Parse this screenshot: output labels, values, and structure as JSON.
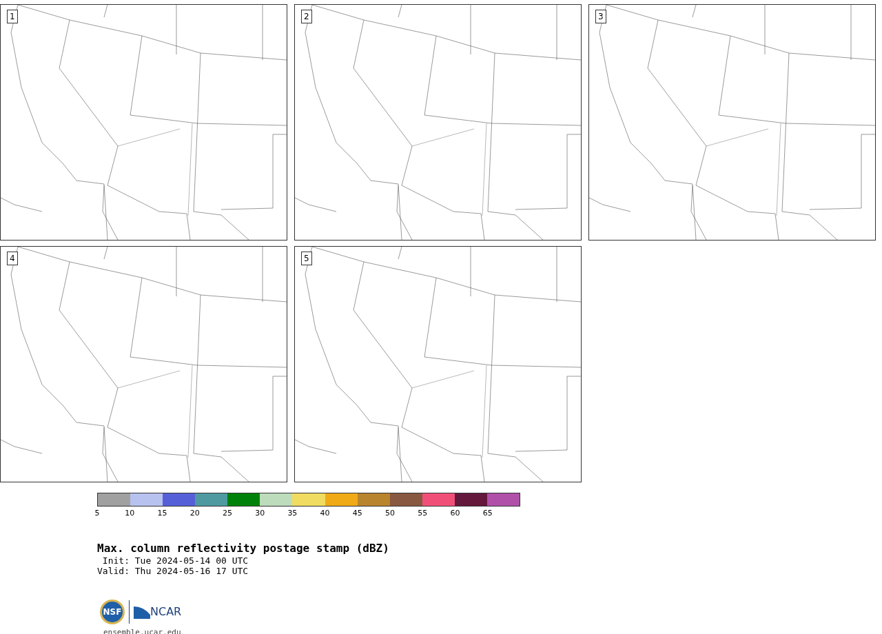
{
  "panels": [
    {
      "number": "1"
    },
    {
      "number": "2"
    },
    {
      "number": "3"
    },
    {
      "number": "4"
    },
    {
      "number": "5"
    }
  ],
  "colorbar": {
    "bins": [
      {
        "color": "#a0a0a0"
      },
      {
        "color": "#b8c2ef"
      },
      {
        "color": "#5560d8"
      },
      {
        "color": "#4e9aa0"
      },
      {
        "color": "#00820a"
      },
      {
        "color": "#bcdcbc"
      },
      {
        "color": "#f0dc60"
      },
      {
        "color": "#f0aa18"
      },
      {
        "color": "#b8842e"
      },
      {
        "color": "#885840"
      },
      {
        "color": "#f05078"
      },
      {
        "color": "#64183c"
      },
      {
        "color": "#b050a8"
      }
    ],
    "ticks": [
      "5",
      "10",
      "15",
      "20",
      "25",
      "30",
      "35",
      "40",
      "45",
      "50",
      "55",
      "60",
      "65"
    ]
  },
  "title": "Max. column reflectivity postage stamp (dBZ)",
  "init": " Init: Tue 2024-05-14 00 UTC",
  "valid": "Valid: Thu 2024-05-16 17 UTC",
  "logo": {
    "left": "NSF",
    "right": "NCAR"
  },
  "url": "ensemble.ucar.edu"
}
